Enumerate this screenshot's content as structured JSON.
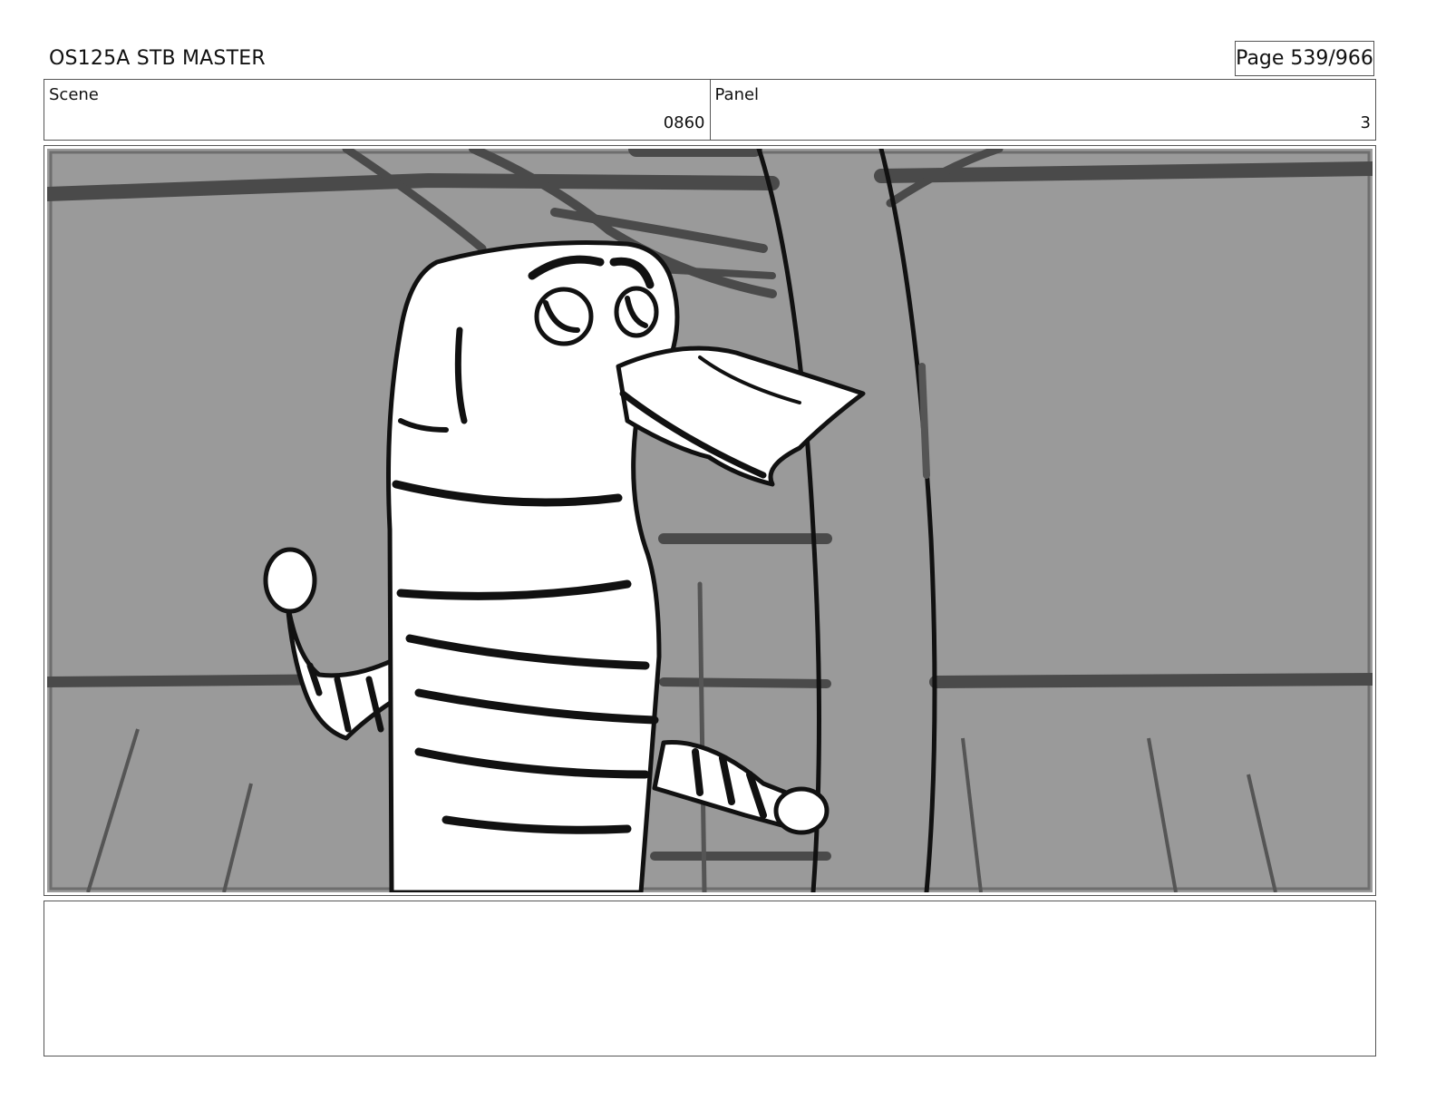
{
  "header": {
    "title": "OS125A  STB MASTER",
    "page": "Page 539/966"
  },
  "info": {
    "scene_label": "Scene",
    "scene_value": "0860",
    "panel_label": "Panel",
    "panel_value": "3"
  },
  "colors": {
    "background_gray": "#9a9a9a",
    "line": "#111111",
    "character_fill": "#ffffff"
  },
  "notes": {
    "text": ""
  }
}
